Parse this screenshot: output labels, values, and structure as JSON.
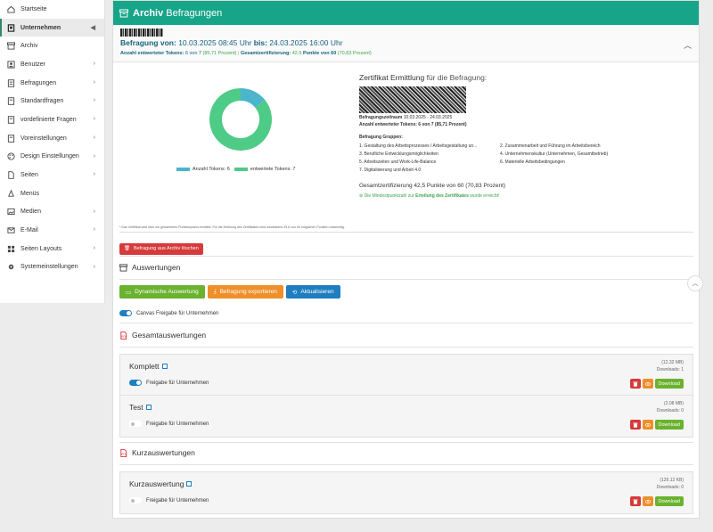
{
  "sidebar": {
    "items": [
      {
        "label": "Startseite",
        "icon": "home-icon",
        "chevron": ""
      },
      {
        "label": "Unternehmen",
        "icon": "building-icon",
        "chevron": "◀",
        "active": true
      },
      {
        "label": "Archiv",
        "icon": "archive-icon",
        "chevron": ""
      },
      {
        "label": "Benutzer",
        "icon": "user-icon",
        "chevron": "›"
      },
      {
        "label": "Befragungen",
        "icon": "survey-icon",
        "chevron": "›"
      },
      {
        "label": "Standardfragen",
        "icon": "folder-icon",
        "chevron": "›"
      },
      {
        "label": "vordefinierte Fragen",
        "icon": "folder-icon",
        "chevron": "›"
      },
      {
        "label": "Voreinstellungen",
        "icon": "folder-icon",
        "chevron": "›"
      },
      {
        "label": "Design Einstellungen",
        "icon": "palette-icon",
        "chevron": "›"
      },
      {
        "label": "Seiten",
        "icon": "page-icon",
        "chevron": "›"
      },
      {
        "label": "Menüs",
        "icon": "menu-icon",
        "chevron": ""
      },
      {
        "label": "Medien",
        "icon": "media-icon",
        "chevron": "›"
      },
      {
        "label": "E-Mail",
        "icon": "mail-icon",
        "chevron": "›"
      },
      {
        "label": "Seiten Layouts",
        "icon": "grid-icon",
        "chevron": "›"
      },
      {
        "label": "Systemeinstellungen",
        "icon": "gear-icon",
        "chevron": "›"
      }
    ]
  },
  "header": {
    "title_bold": "Archiv",
    "title_rest": "Befragungen"
  },
  "summary": {
    "title_prefix": "Befragung von:",
    "from": "10.03.2025 08:45 Uhr",
    "to_label": "bis:",
    "to": "24.03.2025 16:00 Uhr",
    "tokens_label": "Anzahl entwerteter Tokens:",
    "tokens_value": "6 von 7",
    "tokens_pct": "(85,71 Prozent)",
    "cert_label": "Gesamtzertifizierung:",
    "cert_value": "42.5",
    "cert_points_label": "Punkte von 60",
    "cert_pct": "(70,83 Prozent)"
  },
  "chart_data": {
    "type": "pie",
    "categories": [
      "Anzahl Tokens",
      "entwertete Tokens"
    ],
    "values": [
      6,
      7
    ],
    "colors": [
      "#4ab5cc",
      "#4ecb86"
    ],
    "legend": [
      {
        "label": "Anzahl Tokens: 6",
        "color": "#4ab5cc"
      },
      {
        "label": "entwertete Tokens: 7",
        "color": "#4ecb86"
      }
    ],
    "display_slices": [
      0.1429,
      0.8571
    ]
  },
  "certificate": {
    "title_bold": "Zertifikat Ermittlung",
    "title_rest": "für die Befragung:",
    "period_label": "Befragungszeitraum",
    "period_value": "10.03.2025 - 24.03.2025",
    "tokens_text": "Anzahl entwerteter Tokens: 6 von 7 (85,71 Prozent)",
    "groups_label": "Befragung Gruppen:",
    "groups": [
      "1. Gestaltung des Arbeitsprozesses / Arbeitsgestaltung un...",
      "2. Zusammenarbeit und Führung im Arbeitsbereich",
      "3. Berufliche Entwicklungsmöglichkeiten",
      "4. Unternehmenskultur (Unternehmen, Gesamtbetrieb)",
      "5. Arbeitszeiten und Work-Life-Balance",
      "6. Materielle Arbeitsbedingungen",
      "7. Digitalisierung und Arbeit 4.0"
    ],
    "total_text": "Gesamtzertifizierung 42,5 Punkte von 60 (70,83 Prozent)",
    "ok_prefix": "Die Mindestpunktzahl zur",
    "ok_bold": "Erteilung des Zertifikates",
    "ok_suffix": "wurde erreicht!"
  },
  "footnote": "* Das Zertifikat wird über ein gewichtetes Punktesystem ermittelt. Für die Erteilung des Zertifikates sind mindestens 39,6 von 60 möglichen Punkten notwendig.",
  "delete_button": "Befragung aus Archiv löschen",
  "auswertungen": {
    "title": "Auswertungen",
    "btn_dynamic": "Dynamische Auswertung",
    "btn_export": "Befragung exportieren",
    "btn_refresh": "Aktualisieren",
    "canvas_toggle": "Canvas Freigabe für Unternehmen"
  },
  "gesamt": {
    "title": "Gesamtauswertungen",
    "files": [
      {
        "name": "Komplett",
        "size": "(12.32 MB)",
        "downloads": "Downloads: 1",
        "toggle": "Freigabe für Unternehmen",
        "on": true
      },
      {
        "name": "Test",
        "size": "(2.08 MB)",
        "downloads": "Downloads: 0",
        "toggle": "Freigabe für Unternehmen",
        "on": false
      }
    ]
  },
  "kurz": {
    "title": "Kurzauswertungen",
    "files": [
      {
        "name": "Kurzauswertung",
        "size": "(129.12 KB)",
        "downloads": "Downloads: 0",
        "toggle": "Freigabe für Unternehmen",
        "on": false
      }
    ]
  },
  "download_label": "Download"
}
